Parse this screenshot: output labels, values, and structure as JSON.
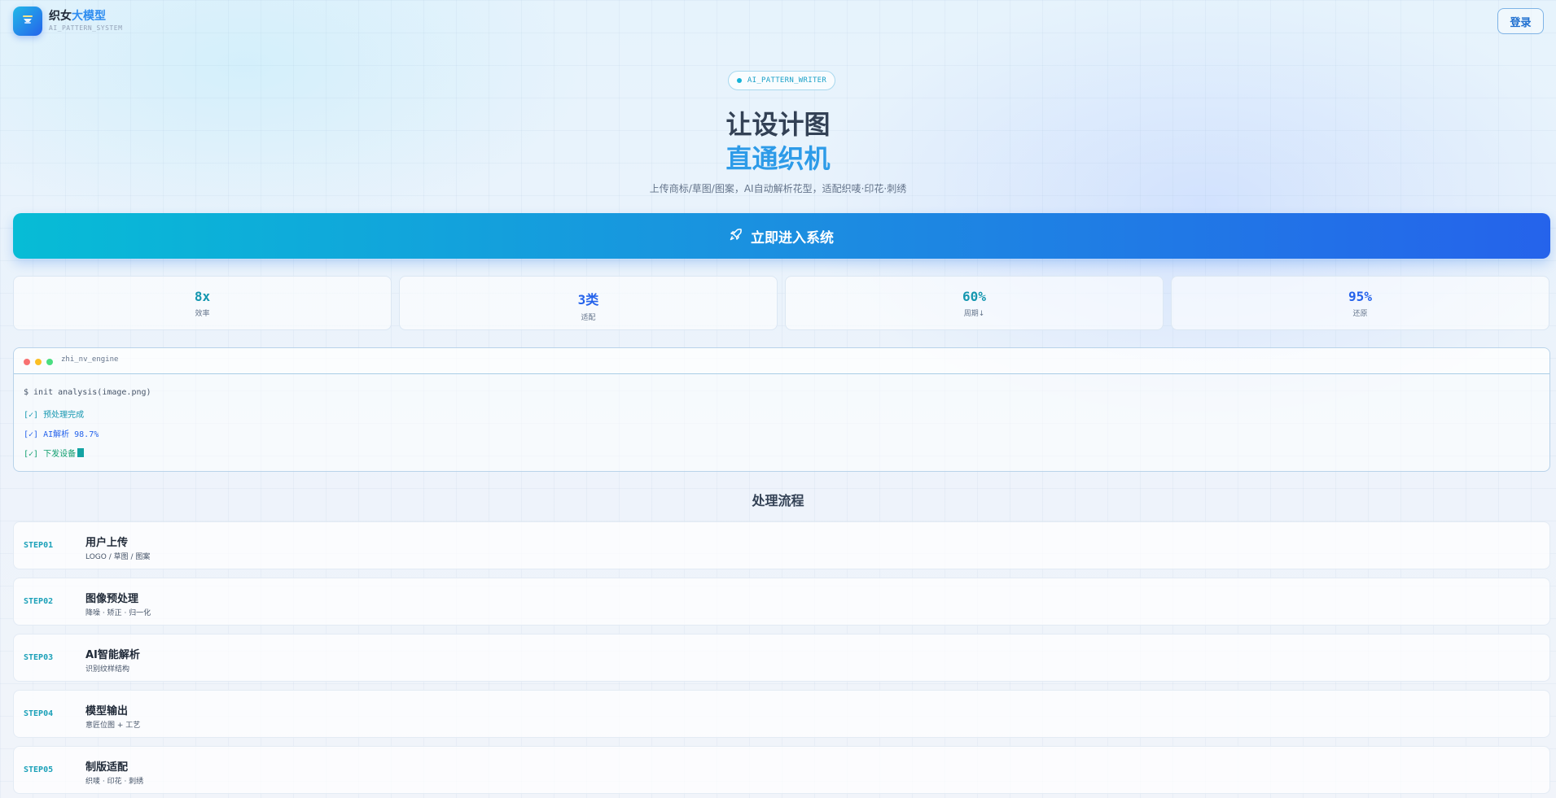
{
  "header": {
    "brand_part1": "织女",
    "brand_part2": "大模型",
    "brand_sub": "AI_PATTERN_SYSTEM",
    "login_label": "登录",
    "logo_icon": "loom-shuttle-icon"
  },
  "hero": {
    "badge": "AI_PATTERN_WRITER",
    "title_line1": "让设计图",
    "title_line2": "直通织机",
    "subtitle": "上传商标/草图/图案，AI自动解析花型，适配织唛·印花·刺绣"
  },
  "cta": {
    "label": "立即进入系统",
    "icon": "rocket-icon"
  },
  "stats": [
    {
      "value": "8x",
      "label": "效率",
      "color": "#1597b0"
    },
    {
      "value": "3类",
      "label": "适配",
      "color": "#2563eb"
    },
    {
      "value": "60%",
      "label": "周期↓",
      "color": "#1597b0"
    },
    {
      "value": "95%",
      "label": "还原",
      "color": "#2563eb"
    }
  ],
  "terminal": {
    "name": "zhi_nv_engine",
    "lines": [
      {
        "text": "$ init analysis(image.png)",
        "color": "#475569"
      },
      {
        "text": "[✓] 预处理完成",
        "color": "#1597b0"
      },
      {
        "text": "[✓] AI解析 98.7%",
        "color": "#2563eb"
      },
      {
        "text": "[✓] 下发设备",
        "color": "#0f9e6e"
      }
    ]
  },
  "process": {
    "title": "处理流程",
    "steps": [
      {
        "num": "STEP01",
        "title": "用户上传",
        "desc": "LOGO / 草图 / 图案"
      },
      {
        "num": "STEP02",
        "title": "图像预处理",
        "desc": "降噪 · 矫正 · 归一化"
      },
      {
        "num": "STEP03",
        "title": "AI智能解析",
        "desc": "识别纹样结构"
      },
      {
        "num": "STEP04",
        "title": "模型输出",
        "desc": "意匠位图 + 工艺"
      },
      {
        "num": "STEP05",
        "title": "制版适配",
        "desc": "织唛 · 印花 · 刺绣"
      }
    ]
  }
}
